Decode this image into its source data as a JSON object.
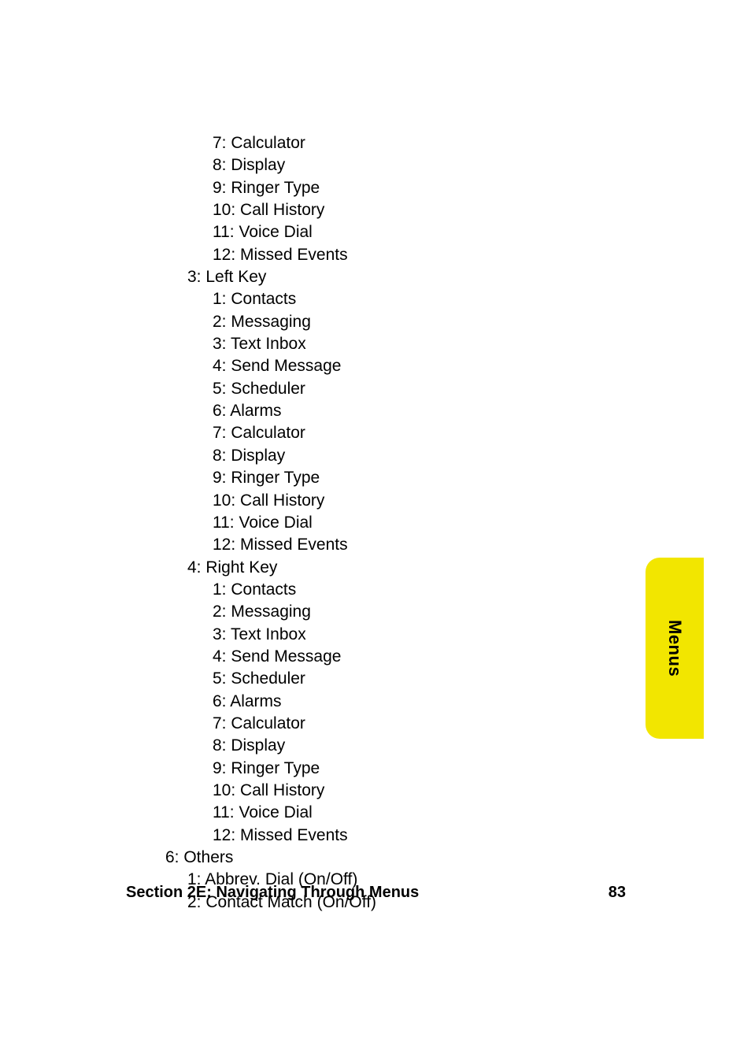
{
  "menu_tree": [
    {
      "indent": 2,
      "text": "7: Calculator"
    },
    {
      "indent": 2,
      "text": "8: Display"
    },
    {
      "indent": 2,
      "text": "9: Ringer Type"
    },
    {
      "indent": 2,
      "text": "10: Call History"
    },
    {
      "indent": 2,
      "text": "11: Voice Dial"
    },
    {
      "indent": 2,
      "text": "12: Missed Events"
    },
    {
      "indent": 1,
      "text": "3: Left Key"
    },
    {
      "indent": 2,
      "text": "1: Contacts"
    },
    {
      "indent": 2,
      "text": "2: Messaging"
    },
    {
      "indent": 2,
      "text": "3: Text Inbox"
    },
    {
      "indent": 2,
      "text": "4: Send Message"
    },
    {
      "indent": 2,
      "text": "5: Scheduler"
    },
    {
      "indent": 2,
      "text": "6: Alarms"
    },
    {
      "indent": 2,
      "text": "7: Calculator"
    },
    {
      "indent": 2,
      "text": "8: Display"
    },
    {
      "indent": 2,
      "text": "9: Ringer Type"
    },
    {
      "indent": 2,
      "text": "10: Call History"
    },
    {
      "indent": 2,
      "text": "11: Voice Dial"
    },
    {
      "indent": 2,
      "text": "12: Missed Events"
    },
    {
      "indent": 1,
      "text": "4: Right Key"
    },
    {
      "indent": 2,
      "text": "1: Contacts"
    },
    {
      "indent": 2,
      "text": "2: Messaging"
    },
    {
      "indent": 2,
      "text": "3: Text Inbox"
    },
    {
      "indent": 2,
      "text": "4: Send Message"
    },
    {
      "indent": 2,
      "text": "5: Scheduler"
    },
    {
      "indent": 2,
      "text": "6: Alarms"
    },
    {
      "indent": 2,
      "text": "7: Calculator"
    },
    {
      "indent": 2,
      "text": "8: Display"
    },
    {
      "indent": 2,
      "text": "9: Ringer Type"
    },
    {
      "indent": 2,
      "text": "10: Call History"
    },
    {
      "indent": 2,
      "text": "11: Voice Dial"
    },
    {
      "indent": 2,
      "text": "12: Missed Events"
    },
    {
      "indent": 0,
      "text": "6: Others"
    },
    {
      "indent": 1,
      "text": "1: Abbrev. Dial (On/Off)"
    },
    {
      "indent": 1,
      "text": "2: Contact Match (On/Off)"
    }
  ],
  "tab": {
    "label": "Menus"
  },
  "footer": {
    "section": "Section 2E: Navigating Through Menus",
    "page": "83"
  }
}
